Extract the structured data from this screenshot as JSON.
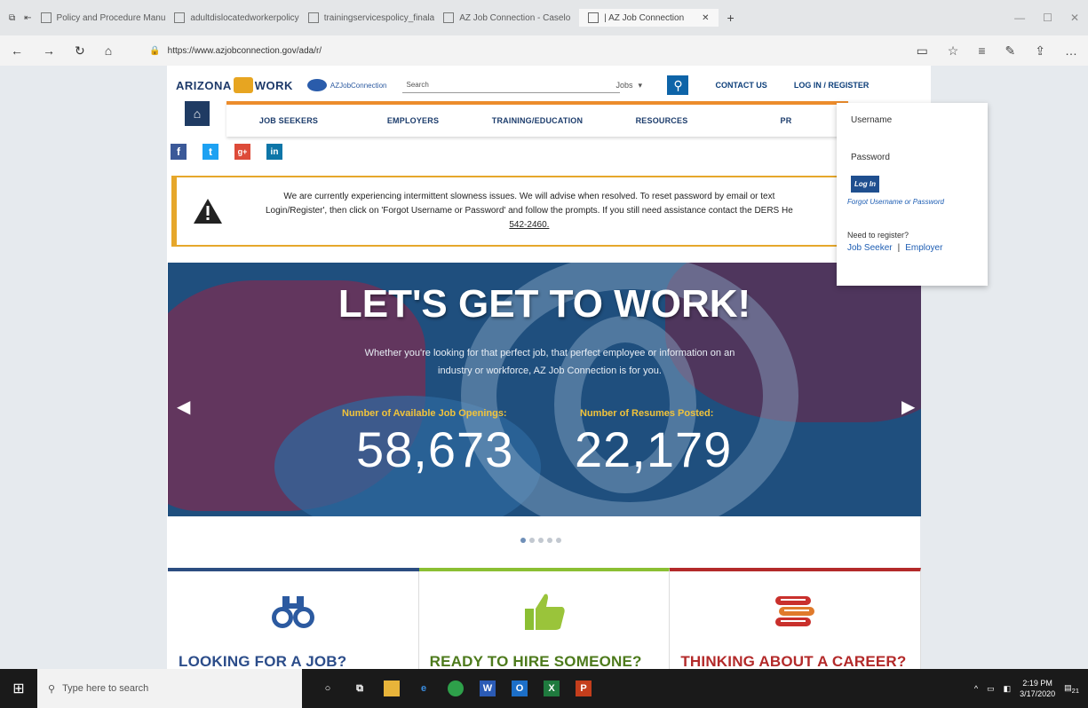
{
  "browser": {
    "tabs": [
      {
        "label": "Policy and Procedure Manu",
        "active": false
      },
      {
        "label": "adultdislocatedworkerpolicy",
        "active": false
      },
      {
        "label": "trainingservicespolicy_finala",
        "active": false
      },
      {
        "label": "AZ Job Connection - Caselo",
        "active": false
      },
      {
        "label": "| AZ Job Connection",
        "active": true
      }
    ],
    "url": "https://www.azjobconnection.gov/ada/r/"
  },
  "header": {
    "logo_left": "ARIZONA",
    "logo_right": "WORK",
    "sub_logo": "AZJobConnection",
    "search_placeholder": "Search",
    "search_category": "Jobs",
    "contact": "CONTACT US",
    "login": "LOG IN / REGISTER"
  },
  "nav": {
    "items": [
      "JOB SEEKERS",
      "EMPLOYERS",
      "TRAINING/EDUCATION",
      "RESOURCES",
      "PR"
    ]
  },
  "social": [
    "f",
    "t",
    "g+",
    "in"
  ],
  "alert": {
    "line1": "We are currently experiencing intermittent slowness issues. We will advise when resolved. To reset password by email or text",
    "line2": "Login/Register', then click on 'Forgot Username or Password' and follow the prompts. If you still need assistance contact the DERS He",
    "line3": "542-2460."
  },
  "hero": {
    "title": "LET'S GET TO WORK!",
    "subtitle_line1": "Whether you're looking for that perfect job, that perfect employee or information on an",
    "subtitle_line2": "industry or workforce, AZ Job Connection is for you.",
    "stat1_label": "Number of Available Job Openings:",
    "stat1_value": "58,673",
    "stat2_label": "Number of Resumes Posted:",
    "stat2_value": "22,179"
  },
  "cards": [
    {
      "title": "LOOKING FOR A JOB?",
      "color": "#2c4d8a",
      "icon": "binoculars-icon"
    },
    {
      "title": "READY TO HIRE SOMEONE?",
      "color": "#4d7a1c",
      "icon": "thumbs-up-icon"
    },
    {
      "title": "THINKING ABOUT A CAREER?",
      "color": "#b32a2a",
      "icon": "books-icon"
    }
  ],
  "login_dropdown": {
    "username_label": "Username",
    "password_label": "Password",
    "login_button": "Log In",
    "forgot": "Forgot Username or Password",
    "need_register": "Need to register?",
    "job_seeker": "Job Seeker",
    "employer": "Employer"
  },
  "taskbar": {
    "search_placeholder": "Type here to search",
    "time": "2:19 PM",
    "date": "3/17/2020",
    "notification_count": "21"
  },
  "colors": {
    "navy": "#1f3b63",
    "gold": "#f1c33b",
    "alert": "#e6a72b",
    "link": "#1d5db3"
  }
}
